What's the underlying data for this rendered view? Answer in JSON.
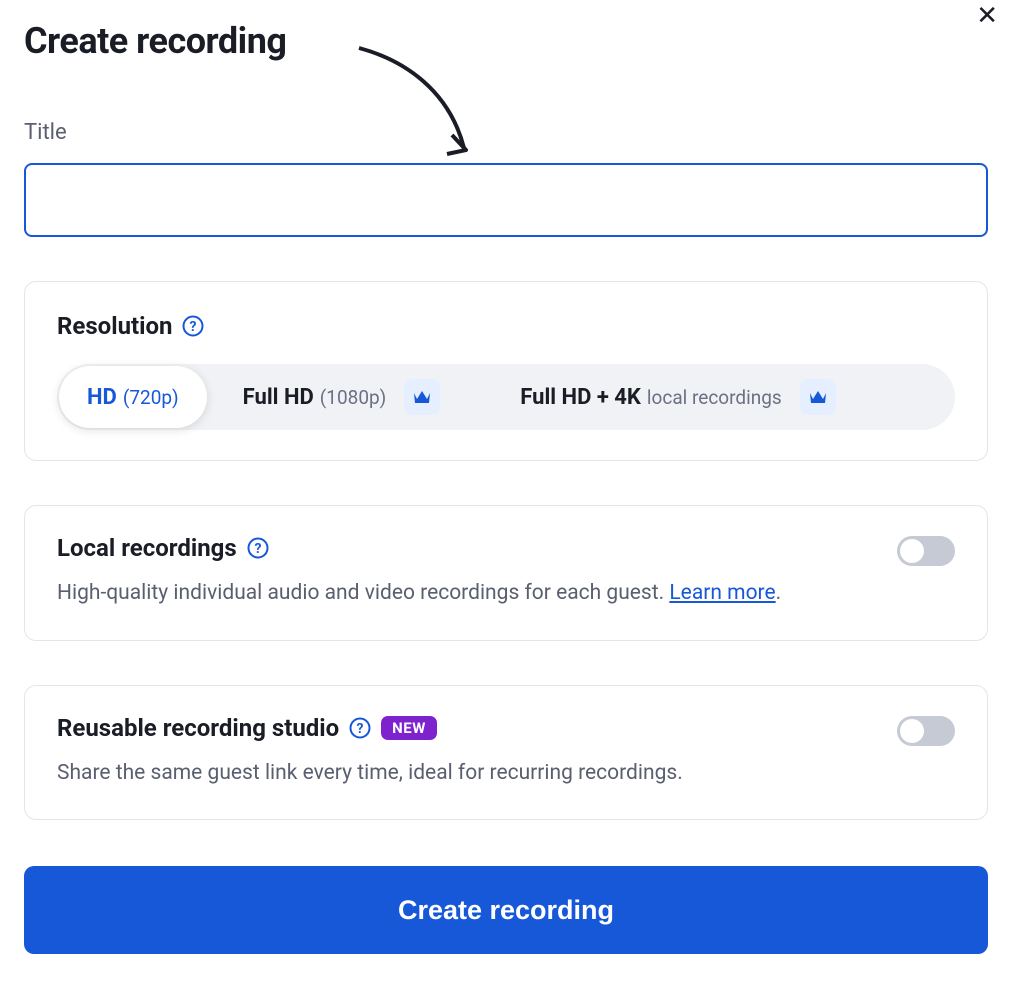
{
  "header": {
    "title": "Create recording"
  },
  "titleField": {
    "label": "Title",
    "value": ""
  },
  "resolution": {
    "title": "Resolution",
    "options": [
      {
        "main": "HD",
        "sub": "(720p)",
        "selected": true,
        "premium": false
      },
      {
        "main": "Full HD",
        "sub": "(1080p)",
        "selected": false,
        "premium": true
      },
      {
        "main": "Full HD + 4K",
        "sub": "local recordings",
        "selected": false,
        "premium": true
      }
    ]
  },
  "localRecordings": {
    "title": "Local recordings",
    "description": "High-quality individual audio and video recordings for each guest. ",
    "learnMore": "Learn more",
    "period": ".",
    "enabled": false
  },
  "reusableStudio": {
    "title": "Reusable recording studio",
    "badge": "NEW",
    "description": "Share the same guest link every time, ideal for recurring recordings.",
    "enabled": false
  },
  "submitButton": {
    "label": "Create recording"
  }
}
